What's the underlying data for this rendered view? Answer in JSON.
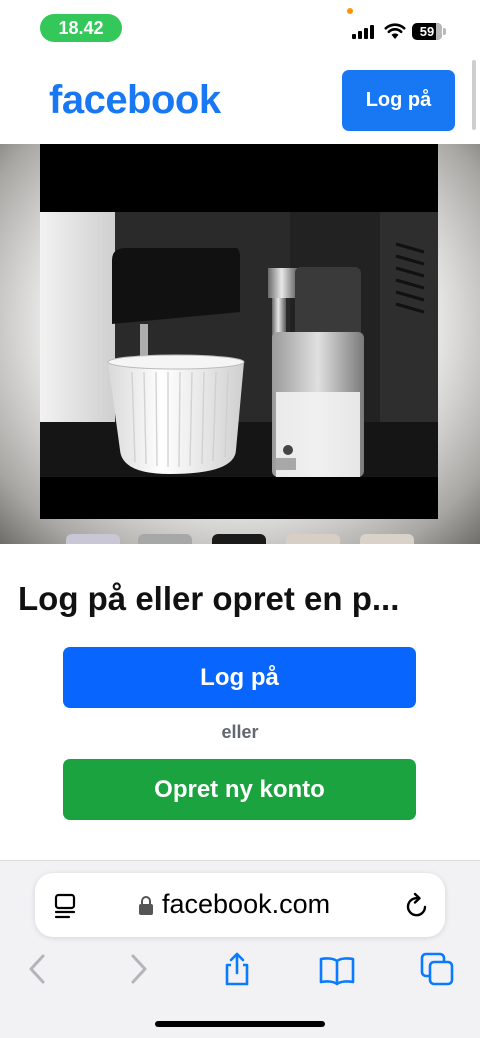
{
  "status_bar": {
    "time": "18.42",
    "battery_level": "59",
    "colors": {
      "time_pill": "#34c759",
      "privacy_dot": "#ff9500"
    }
  },
  "header": {
    "logo": "facebook",
    "login_button": "Log på",
    "colors": {
      "brand": "#1877f2"
    }
  },
  "media": {
    "icons": [
      "coffee-machine-photo"
    ]
  },
  "prompt": {
    "title": "Log på eller opret en p...",
    "login_button": "Log på",
    "or_text": "eller",
    "create_account_button": "Opret ny konto",
    "colors": {
      "login": "#0866ff",
      "create": "#1aa33f"
    }
  },
  "browser": {
    "url": "facebook.com",
    "icons": [
      "reader-icon",
      "lock-icon",
      "reload-icon",
      "back-icon",
      "forward-icon",
      "share-icon",
      "bookmarks-icon",
      "tabs-icon"
    ],
    "colors": {
      "toolbar_icons": "#0a7aff",
      "disabled_icons": "#b5b5b9"
    }
  }
}
